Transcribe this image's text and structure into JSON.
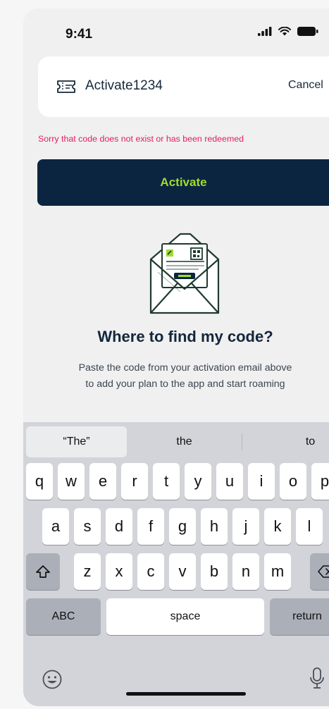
{
  "status_bar": {
    "time": "9:41"
  },
  "code_card": {
    "value": "Activate1234",
    "cancel_label": "Cancel"
  },
  "error": {
    "message": "Sorry that code does not exist or has been redeemed"
  },
  "activate_button": {
    "label": "Activate"
  },
  "help": {
    "title": "Where to find my code?",
    "line1": "Paste the code from your activation email above",
    "line2": "to add  your plan to the app and start roaming"
  },
  "keyboard": {
    "suggestions": [
      "“The”",
      "the",
      "to"
    ],
    "row1": [
      "q",
      "w",
      "e",
      "r",
      "t",
      "y",
      "u",
      "i",
      "o",
      "p"
    ],
    "row2": [
      "a",
      "s",
      "d",
      "f",
      "g",
      "h",
      "j",
      "k",
      "l"
    ],
    "row3": [
      "z",
      "x",
      "c",
      "v",
      "b",
      "n",
      "m"
    ],
    "abc_label": "ABC",
    "space_label": "space",
    "return_label": "return"
  },
  "colors": {
    "accent": "#9fdc2f",
    "navy": "#0b2540",
    "error": "#e2205e"
  }
}
